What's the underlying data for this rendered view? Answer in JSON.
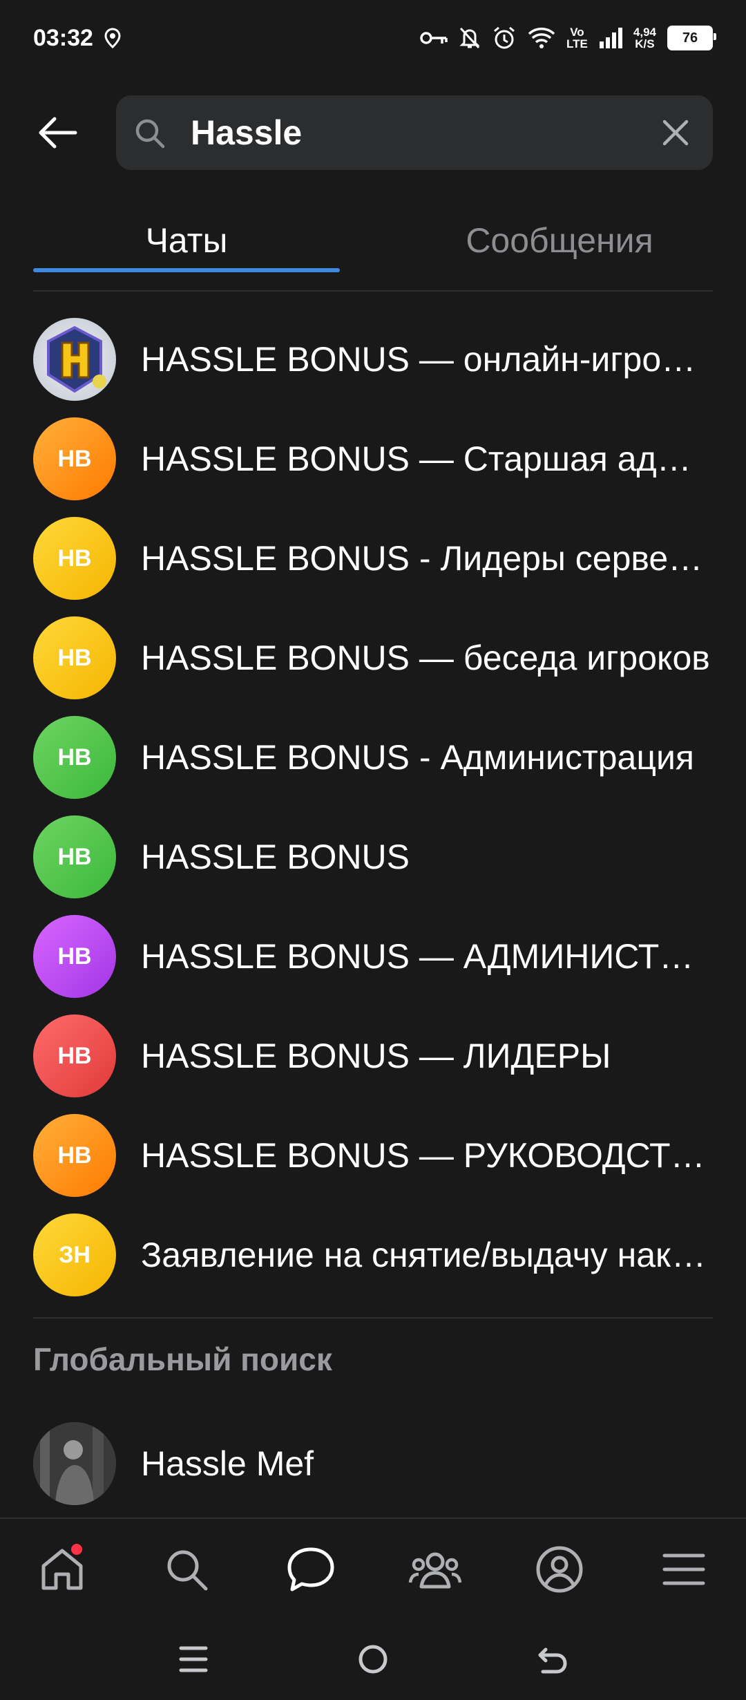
{
  "status_bar": {
    "time": "03:32",
    "network_type_top": "Vo",
    "network_type_bottom": "LTE",
    "speed_value": "4,94",
    "speed_unit": "K/S",
    "battery": "76"
  },
  "search": {
    "query": "Hassle"
  },
  "tabs": [
    {
      "label": "Чаты",
      "active": true
    },
    {
      "label": "Сообщения",
      "active": false
    }
  ],
  "chats": [
    {
      "title": "HASSLE BONUS — онлайн-игровой проект",
      "avatar": "image",
      "avatar_initials": ""
    },
    {
      "title": "HASSLE BONUS — Старшая администрация",
      "avatar_initials": "HB",
      "color": "#ff9a1f"
    },
    {
      "title": "HASSLE BONUS - Лидеры серверов",
      "avatar_initials": "HB",
      "color": "#fcc51e"
    },
    {
      "title": "HASSLE BONUS — беседа игроков",
      "avatar_initials": "HB",
      "color": "#fcc51e"
    },
    {
      "title": "HASSLE BONUS - Администрация",
      "avatar_initials": "HB",
      "color": "#52c74b"
    },
    {
      "title": "HASSLE BONUS",
      "avatar_initials": "HB",
      "color": "#52c74b"
    },
    {
      "title": "HASSLE BONUS — АДМИНИСТРАЦИЯ",
      "avatar_initials": "HB",
      "color": "#be4ff5"
    },
    {
      "title": "HASSLE BONUS — ЛИДЕРЫ",
      "avatar_initials": "HB",
      "color": "#f04a4a"
    },
    {
      "title": "HASSLE BONUS — РУКОВОДСТВО",
      "avatar_initials": "HB",
      "color": "#ff9a1f"
    },
    {
      "title": "Заявление на снятие/выдачу наказаний",
      "avatar_initials": "ЗН",
      "color": "#fcc51e"
    }
  ],
  "global_search": {
    "header": "Глобальный поиск",
    "results": [
      {
        "title": "Hassle Mef"
      }
    ]
  },
  "bottom_nav": [
    {
      "icon": "home-icon",
      "badge": true
    },
    {
      "icon": "search-icon",
      "badge": false
    },
    {
      "icon": "messages-icon",
      "active": true
    },
    {
      "icon": "friends-icon",
      "badge": false
    },
    {
      "icon": "profile-icon",
      "badge": false
    },
    {
      "icon": "menu-icon",
      "badge": false
    }
  ],
  "colors": {
    "background": "#19191a",
    "accent": "#3f8ae0",
    "badge": "#ff3347"
  }
}
